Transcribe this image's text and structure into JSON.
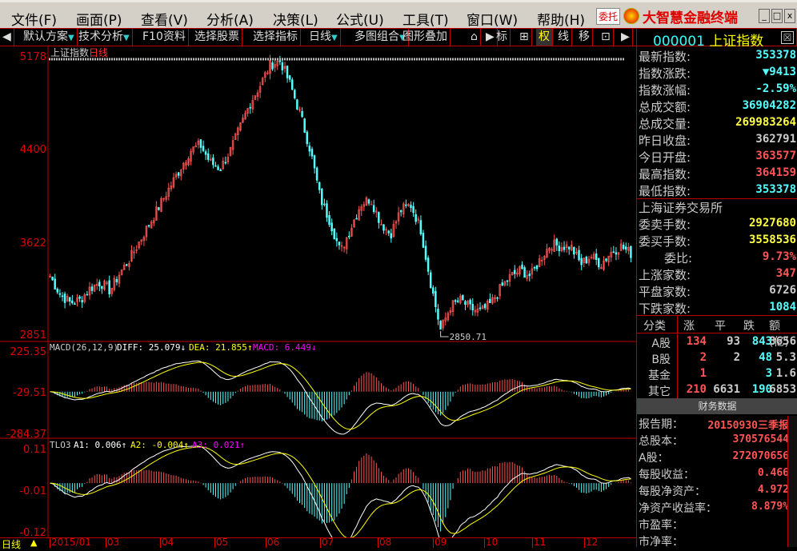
{
  "menu": [
    "文件(F)",
    "画面(P)",
    "查看(V)",
    "分析(A)",
    "决策(L)",
    "公式(U)",
    "工具(T)",
    "窗口(W)",
    "帮助(H)"
  ],
  "brand": {
    "weituo": "委托",
    "name": "大智慧金融终端"
  },
  "window_buttons": [
    "_",
    "□",
    "x"
  ],
  "toolbar": [
    {
      "label": "◀"
    },
    {
      "label": "默认方案",
      "dd": true
    },
    {
      "label": "技术分析",
      "dd": true
    },
    {
      "label": "F10资料"
    },
    {
      "label": "选择股票"
    },
    {
      "label": "选择指标"
    },
    {
      "label": "日线",
      "dd": true
    },
    {
      "label": "多图组合",
      "dd": true
    },
    {
      "label": "图形叠加"
    },
    {
      "label": "⌂"
    },
    {
      "label": "▶"
    },
    {
      "label": "标"
    },
    {
      "label": "⊞"
    },
    {
      "label": "权"
    },
    {
      "label": "线"
    },
    {
      "label": "移"
    },
    {
      "label": "⊡"
    },
    {
      "label": "▶"
    }
  ],
  "security": {
    "code": "000001",
    "name": "上证指数",
    "close_label": "☒"
  },
  "main_chart": {
    "title": "上证指数",
    "period": "日线",
    "y_ticks": [
      "5178",
      "4400",
      "3622",
      "2851"
    ],
    "low_annotation": "2850.71",
    "close_path": [
      3350,
      3200,
      3130,
      3150,
      3250,
      3300,
      3230,
      3380,
      3500,
      3650,
      3800,
      3950,
      4100,
      4250,
      4400,
      4450,
      4300,
      4250,
      4400,
      4600,
      4800,
      4950,
      5120,
      5150,
      4950,
      4700,
      4400,
      4000,
      3800,
      3550,
      3750,
      3950,
      4000,
      3800,
      3700,
      3900,
      3950,
      3750,
      3300,
      2900,
      3100,
      3150,
      3080,
      3050,
      3120,
      3250,
      3350,
      3400,
      3350,
      3500,
      3620,
      3600,
      3600,
      3450,
      3520,
      3450,
      3550,
      3600,
      3540
    ]
  },
  "macd": {
    "name": "MACD(26,12,9)",
    "diff": "DIFF: 25.079↓",
    "dea": "DEA: 21.855↑",
    "macd": "MACD: 6.449↓",
    "y_ticks": [
      "225.35",
      "-29.51",
      "-284.37"
    ]
  },
  "tlo3": {
    "name": "TLO3",
    "a1": "A1: 0.006↑",
    "a2": "A2: -0.004↑",
    "a3": "A3: 0.021↑",
    "y_ticks": [
      "0.11",
      "-0.01",
      "-0.12"
    ]
  },
  "x_axis": {
    "period_label": "日线",
    "months": [
      "2015/01",
      "03",
      "04",
      "05",
      "06",
      "07",
      "08",
      "09",
      "10",
      "11",
      "12"
    ]
  },
  "quote": [
    {
      "label": "最新指数:",
      "value": "353378",
      "color": "#55ffff"
    },
    {
      "label": "指数涨跌:",
      "value": "▼9413",
      "color": "#55ffff"
    },
    {
      "label": "指数涨幅:",
      "value": "-2.59%",
      "color": "#55ffff"
    },
    {
      "label": "总成交额:",
      "value": "36904282",
      "color": "#55ffff"
    },
    {
      "label": "总成交量:",
      "value": "269983264",
      "color": "#ffff44"
    },
    {
      "label": "昨日收盘:",
      "value": "362791",
      "color": "#cccccc"
    },
    {
      "label": "今日开盘:",
      "value": "363577",
      "color": "#ff5555"
    },
    {
      "label": "最高指数:",
      "value": "364159",
      "color": "#ff5555"
    },
    {
      "label": "最低指数:",
      "value": "353378",
      "color": "#55ffff"
    }
  ],
  "exchange": {
    "title": "上海证券交易所",
    "rows": [
      {
        "label": "委卖手数:",
        "value": "2927680",
        "color": "#ffff44"
      },
      {
        "label": "委买手数:",
        "value": "3558536",
        "color": "#ffff44"
      },
      {
        "label": "委比:",
        "value": "9.73%",
        "color": "#ff5555"
      },
      {
        "label": "上涨家数:",
        "value": "347",
        "color": "#ff5555"
      },
      {
        "label": "平盘家数:",
        "value": "6726",
        "color": "#cccccc"
      },
      {
        "label": "下跌家数:",
        "value": "1084",
        "color": "#55ffff"
      }
    ]
  },
  "breadth": {
    "headers": [
      "分类",
      "涨",
      "平",
      "跌",
      "额(亿)"
    ],
    "rows": [
      [
        "A股",
        "134",
        "93",
        "843",
        "3656"
      ],
      [
        "B股",
        "2",
        "2",
        "48",
        "5.3"
      ],
      [
        "基金",
        "1",
        "",
        "3",
        "1.6"
      ],
      [
        "其它",
        "210",
        "6631",
        "190",
        "6853"
      ]
    ]
  },
  "finance": {
    "title": "财务数据",
    "rows": [
      {
        "label": "报告期：",
        "value": "20150930三季报"
      },
      {
        "label": "总股本：",
        "value": "370576544"
      },
      {
        "label": "A股：",
        "value": "272070656"
      },
      {
        "label": "每股收益：",
        "value": "0.466"
      },
      {
        "label": "每股净资产：",
        "value": "4.972"
      },
      {
        "label": "净资产收益率：",
        "value": "8.879%"
      },
      {
        "label": "市盈率：",
        "value": ""
      },
      {
        "label": "市净率：",
        "value": ""
      }
    ]
  },
  "colors": {
    "up": "#ff5555",
    "down": "#55ffff",
    "border": "#bb0000",
    "axis_text": "#e00000"
  }
}
